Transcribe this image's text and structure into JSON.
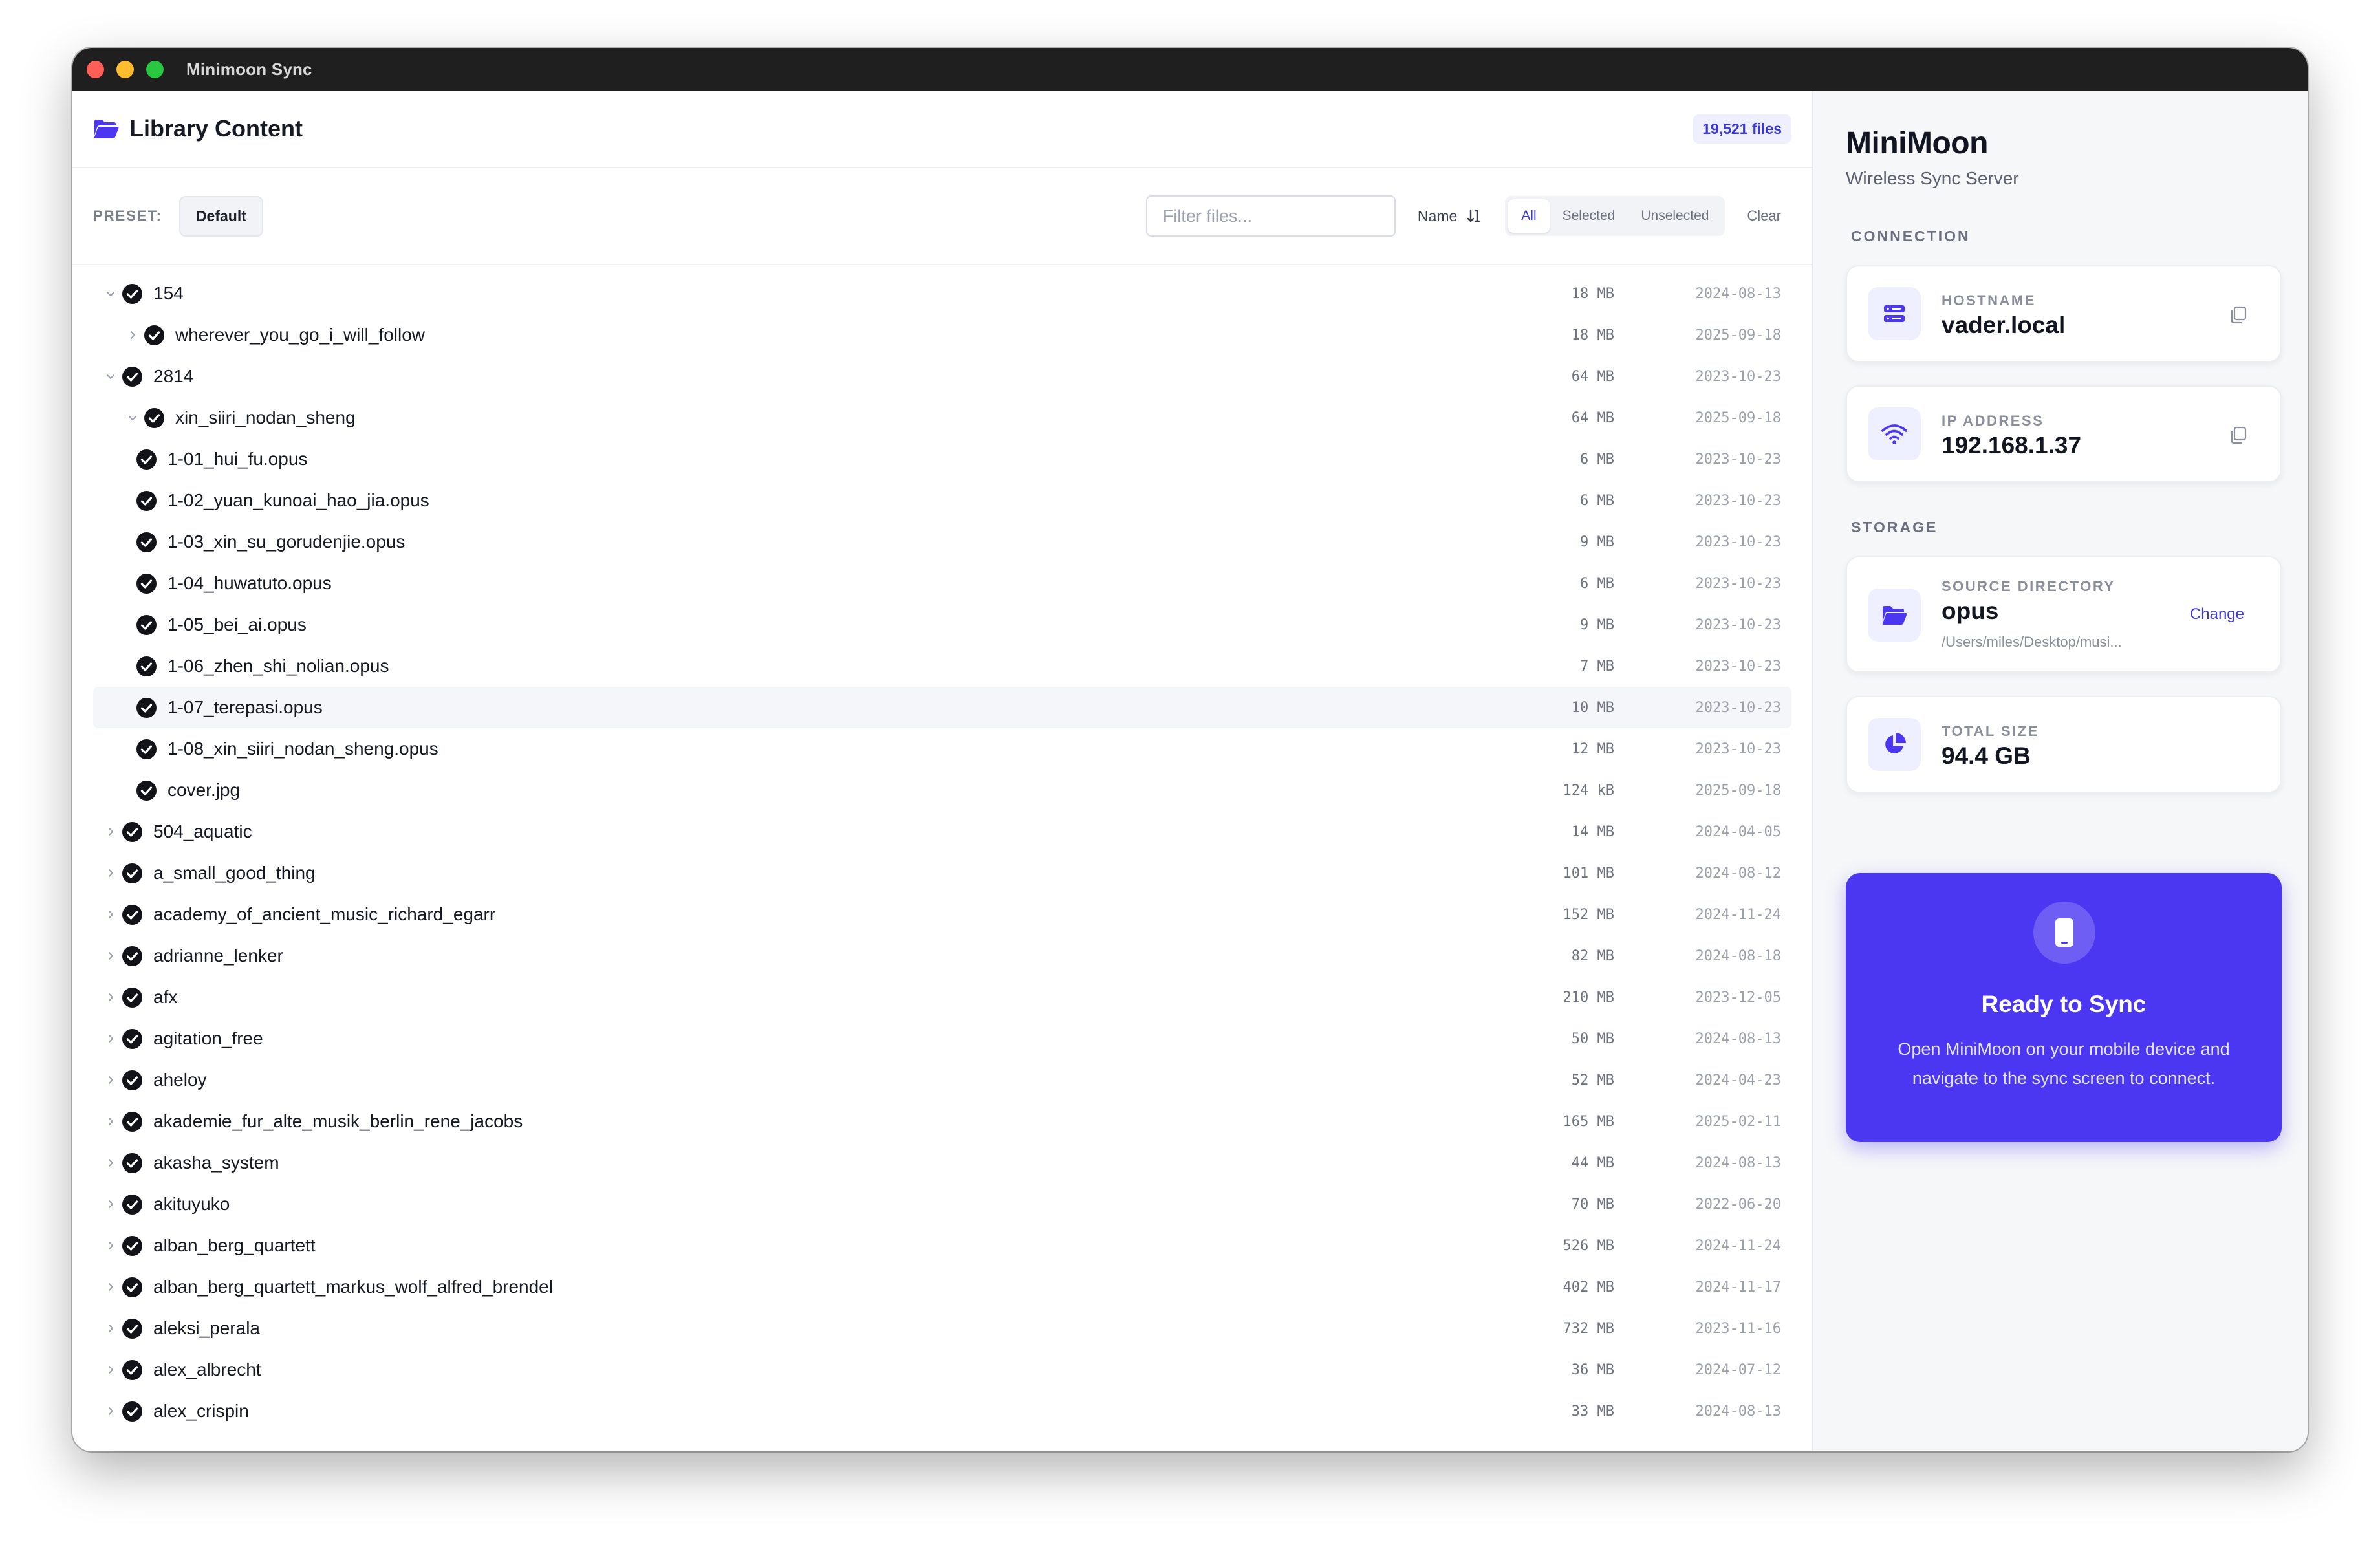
{
  "window": {
    "title": "Minimoon Sync"
  },
  "library": {
    "title": "Library Content",
    "file_count": "19,521 files"
  },
  "toolbar": {
    "preset_label": "PRESET:",
    "preset_value": "Default",
    "filter_placeholder": "Filter files...",
    "sort_label": "Name",
    "filters": [
      "All",
      "Selected",
      "Unselected"
    ],
    "active_filter": "All",
    "clear_label": "Clear"
  },
  "files": [
    {
      "name": "154",
      "size": "18 MB",
      "date": "2024-08-13",
      "depth": 0,
      "chevron": "down"
    },
    {
      "name": "wherever_you_go_i_will_follow",
      "size": "18 MB",
      "date": "2025-09-18",
      "depth": 1,
      "chevron": "right"
    },
    {
      "name": "2814",
      "size": "64 MB",
      "date": "2023-10-23",
      "depth": 0,
      "chevron": "down"
    },
    {
      "name": "xin_siiri_nodan_sheng",
      "size": "64 MB",
      "date": "2025-09-18",
      "depth": 1,
      "chevron": "down"
    },
    {
      "name": "1-01_hui_fu.opus",
      "size": "6 MB",
      "date": "2023-10-23",
      "depth": 2,
      "chevron": "none"
    },
    {
      "name": "1-02_yuan_kunoai_hao_jia.opus",
      "size": "6 MB",
      "date": "2023-10-23",
      "depth": 2,
      "chevron": "none"
    },
    {
      "name": "1-03_xin_su_gorudenjie.opus",
      "size": "9 MB",
      "date": "2023-10-23",
      "depth": 2,
      "chevron": "none"
    },
    {
      "name": "1-04_huwatuto.opus",
      "size": "6 MB",
      "date": "2023-10-23",
      "depth": 2,
      "chevron": "none"
    },
    {
      "name": "1-05_bei_ai.opus",
      "size": "9 MB",
      "date": "2023-10-23",
      "depth": 2,
      "chevron": "none"
    },
    {
      "name": "1-06_zhen_shi_nolian.opus",
      "size": "7 MB",
      "date": "2023-10-23",
      "depth": 2,
      "chevron": "none"
    },
    {
      "name": "1-07_terepasi.opus",
      "size": "10 MB",
      "date": "2023-10-23",
      "depth": 2,
      "chevron": "none",
      "highlight": true
    },
    {
      "name": "1-08_xin_siiri_nodan_sheng.opus",
      "size": "12 MB",
      "date": "2023-10-23",
      "depth": 2,
      "chevron": "none"
    },
    {
      "name": "cover.jpg",
      "size": "124 kB",
      "date": "2025-09-18",
      "depth": 2,
      "chevron": "none"
    },
    {
      "name": "504_aquatic",
      "size": "14 MB",
      "date": "2024-04-05",
      "depth": 0,
      "chevron": "right"
    },
    {
      "name": "a_small_good_thing",
      "size": "101 MB",
      "date": "2024-08-12",
      "depth": 0,
      "chevron": "right"
    },
    {
      "name": "academy_of_ancient_music_richard_egarr",
      "size": "152 MB",
      "date": "2024-11-24",
      "depth": 0,
      "chevron": "right"
    },
    {
      "name": "adrianne_lenker",
      "size": "82 MB",
      "date": "2024-08-18",
      "depth": 0,
      "chevron": "right"
    },
    {
      "name": "afx",
      "size": "210 MB",
      "date": "2023-12-05",
      "depth": 0,
      "chevron": "right"
    },
    {
      "name": "agitation_free",
      "size": "50 MB",
      "date": "2024-08-13",
      "depth": 0,
      "chevron": "right"
    },
    {
      "name": "aheloy",
      "size": "52 MB",
      "date": "2024-04-23",
      "depth": 0,
      "chevron": "right"
    },
    {
      "name": "akademie_fur_alte_musik_berlin_rene_jacobs",
      "size": "165 MB",
      "date": "2025-02-11",
      "depth": 0,
      "chevron": "right"
    },
    {
      "name": "akasha_system",
      "size": "44 MB",
      "date": "2024-08-13",
      "depth": 0,
      "chevron": "right"
    },
    {
      "name": "akituyuko",
      "size": "70 MB",
      "date": "2022-06-20",
      "depth": 0,
      "chevron": "right"
    },
    {
      "name": "alban_berg_quartett",
      "size": "526 MB",
      "date": "2024-11-24",
      "depth": 0,
      "chevron": "right"
    },
    {
      "name": "alban_berg_quartett_markus_wolf_alfred_brendel",
      "size": "402 MB",
      "date": "2024-11-17",
      "depth": 0,
      "chevron": "right"
    },
    {
      "name": "aleksi_perala",
      "size": "732 MB",
      "date": "2023-11-16",
      "depth": 0,
      "chevron": "right"
    },
    {
      "name": "alex_albrecht",
      "size": "36 MB",
      "date": "2024-07-12",
      "depth": 0,
      "chevron": "right"
    },
    {
      "name": "alex_crispin",
      "size": "33 MB",
      "date": "2024-08-13",
      "depth": 0,
      "chevron": "right"
    }
  ],
  "sidebar": {
    "app_name": "MiniMoon",
    "subtitle": "Wireless Sync Server",
    "connection_label": "CONNECTION",
    "hostname": {
      "label": "HOSTNAME",
      "value": "vader.local"
    },
    "ip": {
      "label": "IP ADDRESS",
      "value": "192.168.1.37"
    },
    "storage_label": "STORAGE",
    "source": {
      "label": "SOURCE DIRECTORY",
      "value": "opus",
      "path": "/Users/miles/Desktop/musi...",
      "action": "Change"
    },
    "total": {
      "label": "TOTAL SIZE",
      "value": "94.4 GB"
    },
    "sync": {
      "title": "Ready to Sync",
      "description": "Open MiniMoon on your mobile device and navigate to the sync screen to connect."
    }
  },
  "colors": {
    "accent": "#4b36f2",
    "accent_text": "#3b38d6",
    "icon_bg": "#eef0ff"
  }
}
